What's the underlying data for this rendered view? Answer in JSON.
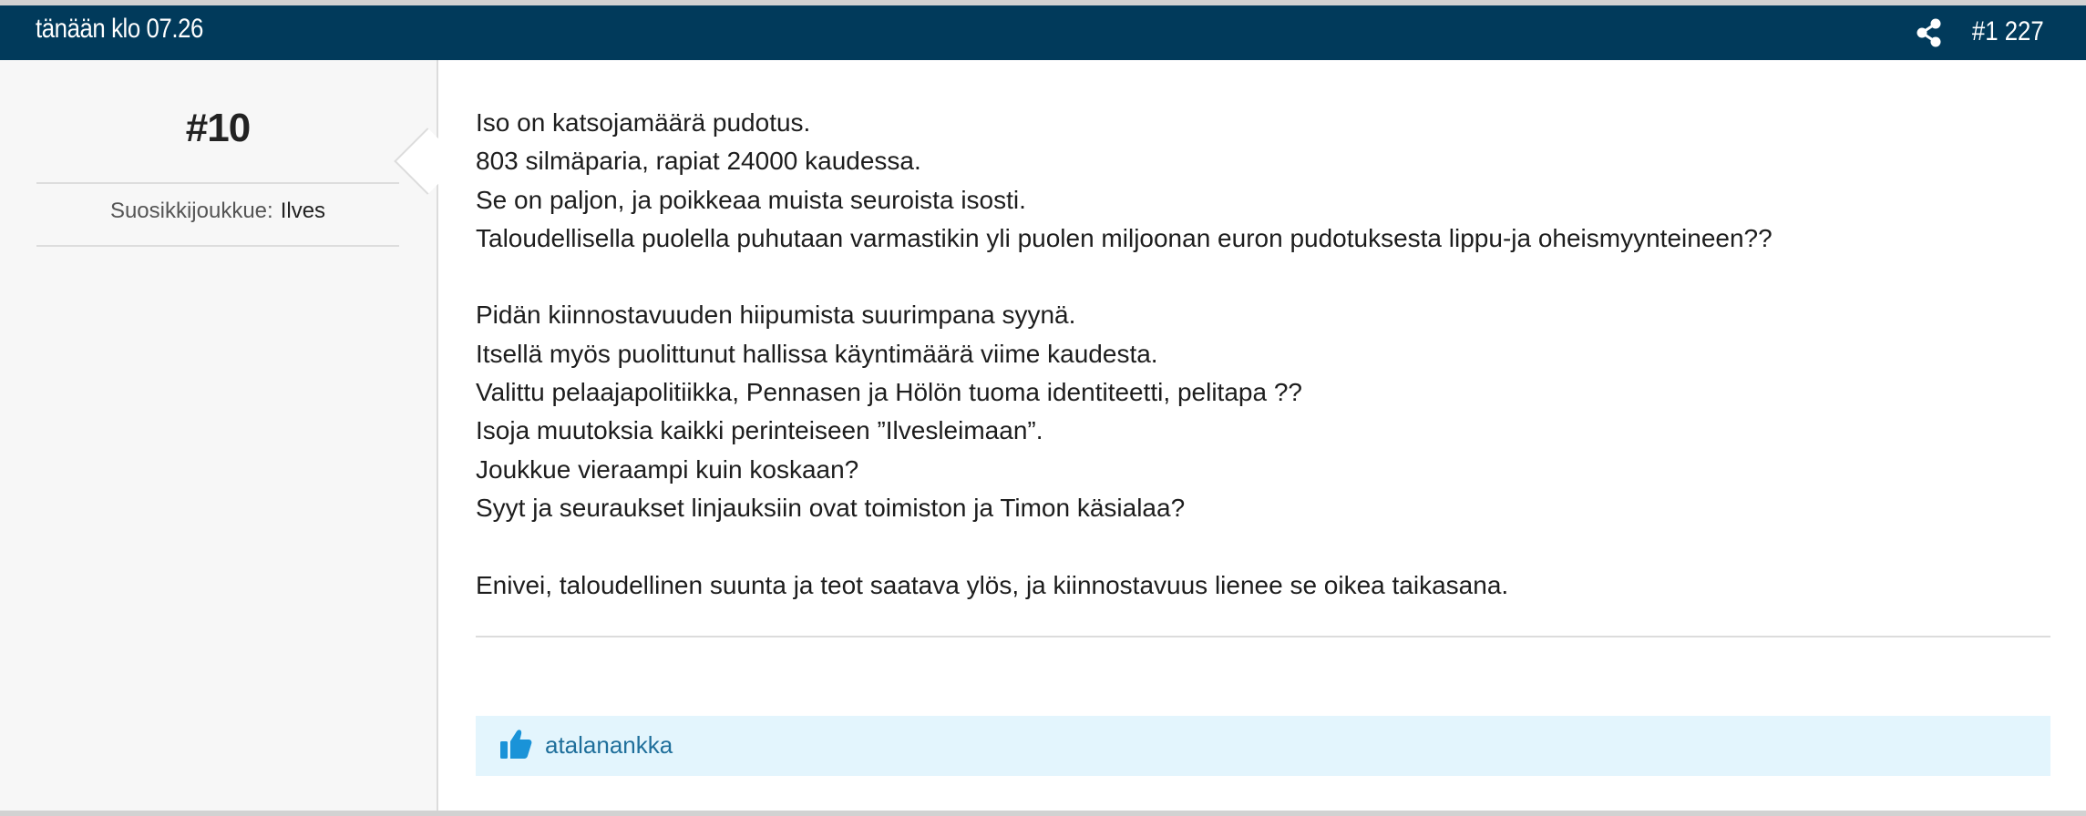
{
  "header": {
    "timestamp": "tänään klo 07.26",
    "post_number": "#1 227",
    "share_icon": "share-icon"
  },
  "user": {
    "name": "#10",
    "favorite_team_label": "Suosikkijoukkue:",
    "favorite_team": "Ilves"
  },
  "post": {
    "paragraphs": [
      [
        "Iso on katsojamäärä pudotus.",
        "803 silmäparia, rapiat 24000 kaudessa.",
        "Se on paljon, ja poikkeaa muista seuroista isosti.",
        "Taloudellisella puolella puhutaan varmastikin yli puolen miljoonan euron pudotuksesta lippu-ja oheismyynteineen??"
      ],
      [
        "Pidän kiinnostavuuden hiipumista suurimpana syynä.",
        "Itsellä myös puolittunut hallissa käyntimäärä viime kaudesta.",
        "Valittu pelaajapolitiikka, Pennasen ja Hölön tuoma identiteetti, pelitapa ??",
        "Isoja muutoksia kaikki perinteiseen ”Ilvesleimaan”.",
        "Joukkue vieraampi kuin koskaan?",
        "Syyt ja seuraukset linjauksiin ovat toimiston ja Timon käsialaa?"
      ],
      [
        "Enivei, taloudellinen suunta ja teot saatava ylös, ja kiinnostavuus lienee se oikea taikasana."
      ]
    ]
  },
  "likes": {
    "icon": "thumbs-up-icon",
    "users": [
      "atalanankka"
    ]
  },
  "colors": {
    "header_bg": "#013a5b",
    "likes_bg": "#e3f5fd",
    "accent": "#1f6f9b"
  }
}
